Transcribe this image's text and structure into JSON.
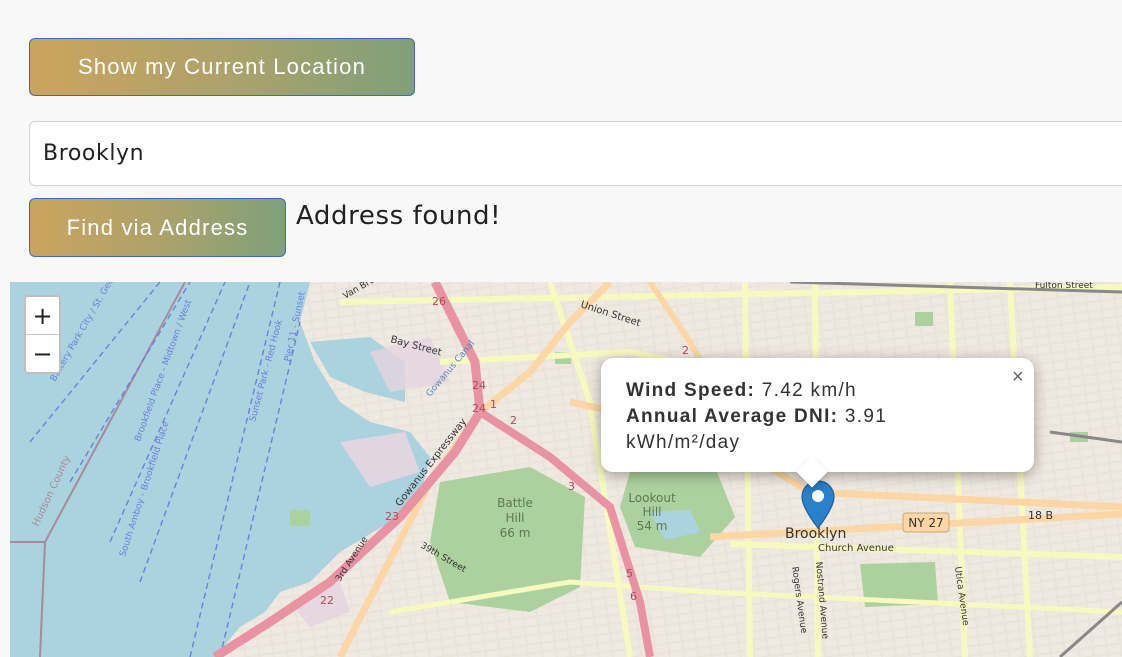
{
  "buttons": {
    "current_location": "Show my Current Location",
    "find_address": "Find via Address"
  },
  "address_input": {
    "value": "Brooklyn"
  },
  "status_text": "Address found!",
  "zoom": {
    "in": "+",
    "out": "−"
  },
  "popup": {
    "wind_label": "Wind Speed:",
    "wind_value": "7.42 km/h",
    "dni_label": "Annual Average DNI:",
    "dni_value": "3.91",
    "dni_unit": "kWh/m²/day",
    "close": "×"
  },
  "map_labels": {
    "battle_hill": [
      "Battle",
      "Hill",
      "66 m"
    ],
    "lookout_hill": [
      "Lookout",
      "Hill",
      "54 m"
    ],
    "brooklyn": "Brooklyn",
    "ny27": "NY 27",
    "church_ave": "Church Avenue",
    "union_street": "Union Street",
    "bay_street": "Bay Street",
    "fulton_street": "Fulton Street",
    "hudson_county": "Hudson County",
    "expressway": "Gowanus Expressway",
    "third_ave": "3rd Avenue",
    "thirty_ninth": "39th Street",
    "rogers": "Rogers Avenue",
    "nostrand": "Nostrand Avenue",
    "utica": "Utica Avenue",
    "van_brunt": "Van Brunt",
    "gowanus_canal": "Gowanus Canal",
    "ferry1": "Battery Park City / St. George Route",
    "ferry2": "Brookfield Place - Midtown / West",
    "ferry3": "South Amboy - Brookfield Place",
    "ferry4": "Sunset Park - Red Hook",
    "pier11": "Pier 11 - Sunset",
    "exit_24": "24",
    "exit_23": "23",
    "exit_22": "22",
    "exit_26": "26",
    "exit_3": "3",
    "exit_2": "2",
    "exit_5": "5",
    "exit_6": "6",
    "exit_1": "1",
    "eighteen_b": "18 B",
    "two_b": "2"
  },
  "colors": {
    "water": "#aad3df",
    "park": "#add19e",
    "highway": "#e892a2",
    "primary": "#fcd6a4",
    "secondary": "#f7fabf",
    "marker": "#2a81cb"
  }
}
